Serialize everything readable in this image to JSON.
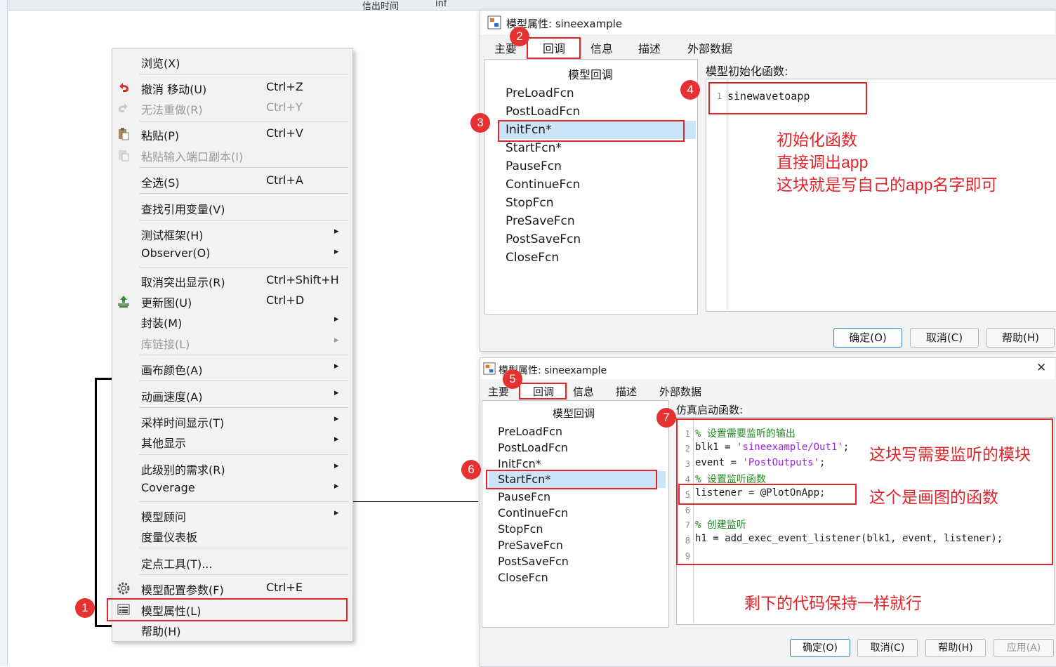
{
  "background": {
    "col_labels": [
      "信出时间",
      "inf"
    ]
  },
  "context_menu": {
    "items": [
      {
        "label": "浏览(X)",
        "shortcut": "",
        "arrow": false,
        "disabled": false,
        "icon": ""
      },
      {
        "label": "撤消 移动(U)",
        "shortcut": "Ctrl+Z",
        "arrow": false,
        "disabled": false,
        "icon": "undo-icon"
      },
      {
        "label": "无法重做(R)",
        "shortcut": "Ctrl+Y",
        "arrow": false,
        "disabled": true,
        "icon": "redo-icon"
      },
      {
        "label": "粘贴(P)",
        "shortcut": "Ctrl+V",
        "arrow": false,
        "disabled": false,
        "icon": "paste-icon"
      },
      {
        "label": "粘贴输入端口副本(I)",
        "shortcut": "",
        "arrow": false,
        "disabled": true,
        "icon": "paste-port-icon"
      },
      {
        "label": "全选(S)",
        "shortcut": "Ctrl+A",
        "arrow": false,
        "disabled": false,
        "icon": ""
      },
      {
        "label": "查找引用变量(V)",
        "shortcut": "",
        "arrow": false,
        "disabled": false,
        "icon": ""
      },
      {
        "label": "测试框架(H)",
        "shortcut": "",
        "arrow": true,
        "disabled": false,
        "icon": ""
      },
      {
        "label": "Observer(O)",
        "shortcut": "",
        "arrow": true,
        "disabled": false,
        "icon": ""
      },
      {
        "label": "取消突出显示(R)",
        "shortcut": "Ctrl+Shift+H",
        "arrow": false,
        "disabled": false,
        "icon": ""
      },
      {
        "label": "更新图(U)",
        "shortcut": "Ctrl+D",
        "arrow": false,
        "disabled": false,
        "icon": "update-diagram-icon"
      },
      {
        "label": "封装(M)",
        "shortcut": "",
        "arrow": true,
        "disabled": false,
        "icon": ""
      },
      {
        "label": "库链接(L)",
        "shortcut": "",
        "arrow": true,
        "disabled": true,
        "icon": ""
      },
      {
        "label": "画布颜色(A)",
        "shortcut": "",
        "arrow": true,
        "disabled": false,
        "icon": ""
      },
      {
        "label": "动画速度(A)",
        "shortcut": "",
        "arrow": true,
        "disabled": false,
        "icon": ""
      },
      {
        "label": "采样时间显示(T)",
        "shortcut": "",
        "arrow": true,
        "disabled": false,
        "icon": ""
      },
      {
        "label": "其他显示",
        "shortcut": "",
        "arrow": true,
        "disabled": false,
        "icon": ""
      },
      {
        "label": "此级别的需求(R)",
        "shortcut": "",
        "arrow": true,
        "disabled": false,
        "icon": ""
      },
      {
        "label": "Coverage",
        "shortcut": "",
        "arrow": true,
        "disabled": false,
        "icon": ""
      },
      {
        "label": "模型顾问",
        "shortcut": "",
        "arrow": true,
        "disabled": false,
        "icon": ""
      },
      {
        "label": "度量仪表板",
        "shortcut": "",
        "arrow": false,
        "disabled": false,
        "icon": ""
      },
      {
        "label": "定点工具(T)...",
        "shortcut": "",
        "arrow": false,
        "disabled": false,
        "icon": ""
      },
      {
        "label": "模型配置参数(F)",
        "shortcut": "Ctrl+E",
        "arrow": false,
        "disabled": false,
        "icon": "gear-icon"
      },
      {
        "label": "模型属性(L)",
        "shortcut": "",
        "arrow": false,
        "disabled": false,
        "icon": "properties-list-icon"
      },
      {
        "label": "帮助(H)",
        "shortcut": "",
        "arrow": false,
        "disabled": false,
        "icon": ""
      }
    ]
  },
  "badges": [
    "1",
    "2",
    "3",
    "4",
    "5",
    "6",
    "7"
  ],
  "dialog1": {
    "title": "模型属性: sineexample",
    "tabs": [
      "主要",
      "回调",
      "信息",
      "描述",
      "外部数据"
    ],
    "active_tab": "回调",
    "callbacks_title": "模型回调",
    "callbacks": [
      "PreLoadFcn",
      "PostLoadFcn",
      "InitFcn*",
      "StartFcn*",
      "PauseFcn",
      "ContinueFcn",
      "StopFcn",
      "PreSaveFcn",
      "PostSaveFcn",
      "CloseFcn"
    ],
    "selected_callback": "InitFcn*",
    "fn_label": "模型初始化函数:",
    "code": [
      {
        "n": "1",
        "text": "sinewavetoapp"
      }
    ],
    "buttons": {
      "ok": "确定(O)",
      "cancel": "取消(C)",
      "help": "帮助(H)"
    }
  },
  "dialog2": {
    "title": "模型属性: sineexample",
    "tabs": [
      "主要",
      "回调",
      "信息",
      "描述",
      "外部数据"
    ],
    "active_tab": "回调",
    "callbacks_title": "模型回调",
    "callbacks": [
      "PreLoadFcn",
      "PostLoadFcn",
      "InitFcn*",
      "StartFcn*",
      "PauseFcn",
      "ContinueFcn",
      "StopFcn",
      "PreSaveFcn",
      "PostSaveFcn",
      "CloseFcn"
    ],
    "selected_callback": "StartFcn*",
    "fn_label": "仿真启动函数:",
    "code": [
      {
        "n": "1",
        "comment": "% 设置需要监听的输出"
      },
      {
        "n": "2",
        "pre": "blk1 = ",
        "str": "'sineexample/Out1'",
        "post": ";"
      },
      {
        "n": "3",
        "pre": "event = ",
        "str": "'PostOutputs'",
        "post": ";"
      },
      {
        "n": "4",
        "comment": "% 设置监听函数"
      },
      {
        "n": "5",
        "pre": "listener = @PlotOnApp;"
      },
      {
        "n": "6",
        "pre": ""
      },
      {
        "n": "7",
        "comment": "% 创建监听"
      },
      {
        "n": "8",
        "pre": "h1 = add_exec_event_listener(blk1, event, listener);"
      },
      {
        "n": "9",
        "pre": ""
      }
    ],
    "close": "✕",
    "buttons": {
      "ok": "确定(O)",
      "cancel": "取消(C)",
      "help": "帮助(H)",
      "apply": "应用(A)"
    }
  },
  "annotations": {
    "init_note": [
      "初始化函数",
      "直接调出app",
      "这块就是写自己的app名字即可"
    ],
    "monitor_note": "这块写需要监听的模块",
    "plot_note": "这个是画图的函数",
    "rest_note": "剩下的代码保持一样就行"
  },
  "colors": {
    "highlight_red": "#e0262b",
    "selection_blue": "#cce4f7",
    "comment_green": "#228b22",
    "string_purple": "#a020f0"
  }
}
